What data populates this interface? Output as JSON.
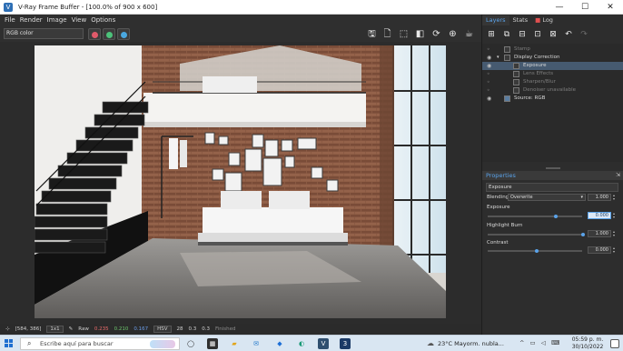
{
  "window": {
    "title": "V-Ray Frame Buffer - [100.0% of 900 x 600]",
    "controls": [
      "—",
      "☐",
      "✕"
    ]
  },
  "menu": [
    "File",
    "Render",
    "Image",
    "View",
    "Options"
  ],
  "toolbar": {
    "channel": "RGB color",
    "channel_buttons": [
      {
        "name": "red",
        "color": "#e05a6a"
      },
      {
        "name": "green",
        "color": "#4cc27a"
      },
      {
        "name": "blue",
        "color": "#4aa8e0"
      }
    ],
    "render_tools": [
      "save-icon",
      "clear-icon",
      "region-icon",
      "camera-icon",
      "refresh-icon",
      "lock-icon",
      "teapot-icon"
    ]
  },
  "status_bar": {
    "coords": "[584, 386]",
    "zoom": "1x1",
    "mode": "Raw",
    "r": "0.235",
    "g": "0.210",
    "b": "0.167",
    "colorspace": "HSV",
    "h": "28",
    "s": "0.3",
    "v": "0.3",
    "state": "Finished",
    "r_color": "#e86b6b",
    "g_color": "#6cc56c",
    "b_color": "#6b9de8"
  },
  "right_panel": {
    "tabs": [
      "Layers",
      "Stats",
      "Log"
    ],
    "active_tab": "Layers",
    "layer_tools": [
      "add-layer-icon",
      "copy-layer-icon",
      "save-layer-icon",
      "load-layer-icon",
      "delete-layer-icon",
      "undo-icon",
      "redo-icon"
    ],
    "layers": [
      {
        "label": "Stamp",
        "visible": false,
        "indent": 1,
        "dim": true
      },
      {
        "label": "Display Correction",
        "visible": true,
        "indent": 1,
        "dim": false
      },
      {
        "label": "Exposure",
        "visible": true,
        "indent": 2,
        "dim": false,
        "selected": true
      },
      {
        "label": "Lens Effects",
        "visible": false,
        "indent": 2,
        "dim": true
      },
      {
        "label": "Sharpen/Blur",
        "visible": false,
        "indent": 2,
        "dim": true
      },
      {
        "label": "Denoiser unavailable",
        "visible": false,
        "indent": 2,
        "dim": true
      },
      {
        "label": "Source: RGB",
        "visible": true,
        "indent": 1,
        "dim": false
      }
    ],
    "properties": {
      "title": "Properties",
      "layer_name": "Exposure",
      "blending_label": "Blending",
      "blending_mode": "Overwrite",
      "blending_value": "1.000",
      "exposure_label": "Exposure",
      "exposure_value": "0.000",
      "highlight_label": "Highlight Burn",
      "highlight_value": "1.000",
      "contrast_label": "Contrast",
      "contrast_value": "0.000"
    }
  },
  "taskbar": {
    "search_placeholder": "Escribe aquí para buscar",
    "weather_temp": "23°C",
    "weather_desc": "Mayorm. nubla...",
    "time": "05:59 p. m.",
    "date": "30/10/2022"
  }
}
